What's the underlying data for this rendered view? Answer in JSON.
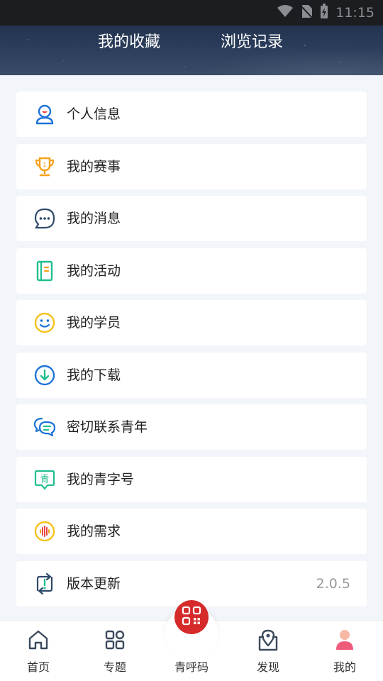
{
  "status_bar": {
    "time": "11:15"
  },
  "header": {
    "tab_favorites": "我的收藏",
    "tab_history": "浏览记录"
  },
  "menu": [
    {
      "label": "个人信息",
      "icon": "user-profile-icon"
    },
    {
      "label": "我的赛事",
      "icon": "trophy-icon"
    },
    {
      "label": "我的消息",
      "icon": "chat-bubble-icon"
    },
    {
      "label": "我的活动",
      "icon": "notebook-icon"
    },
    {
      "label": "我的学员",
      "icon": "smiley-icon"
    },
    {
      "label": "我的下载",
      "icon": "download-icon"
    },
    {
      "label": "密切联系青年",
      "icon": "chat-bubbles-icon"
    },
    {
      "label": "我的青字号",
      "icon": "qing-badge-icon",
      "badge_text": "青"
    },
    {
      "label": "我的需求",
      "icon": "audio-wave-icon"
    },
    {
      "label": "版本更新",
      "icon": "update-icon",
      "value": "2.0.5"
    }
  ],
  "tabbar": {
    "home": "首页",
    "topics": "专题",
    "qr": "青呼码",
    "discover": "发现",
    "mine": "我的"
  },
  "colors": {
    "accent_red": "#d62a2a",
    "icon_blue": "#1e73d8",
    "icon_orange": "#f5a11a",
    "icon_green": "#1fbf8f",
    "icon_yellow": "#f5c218"
  }
}
